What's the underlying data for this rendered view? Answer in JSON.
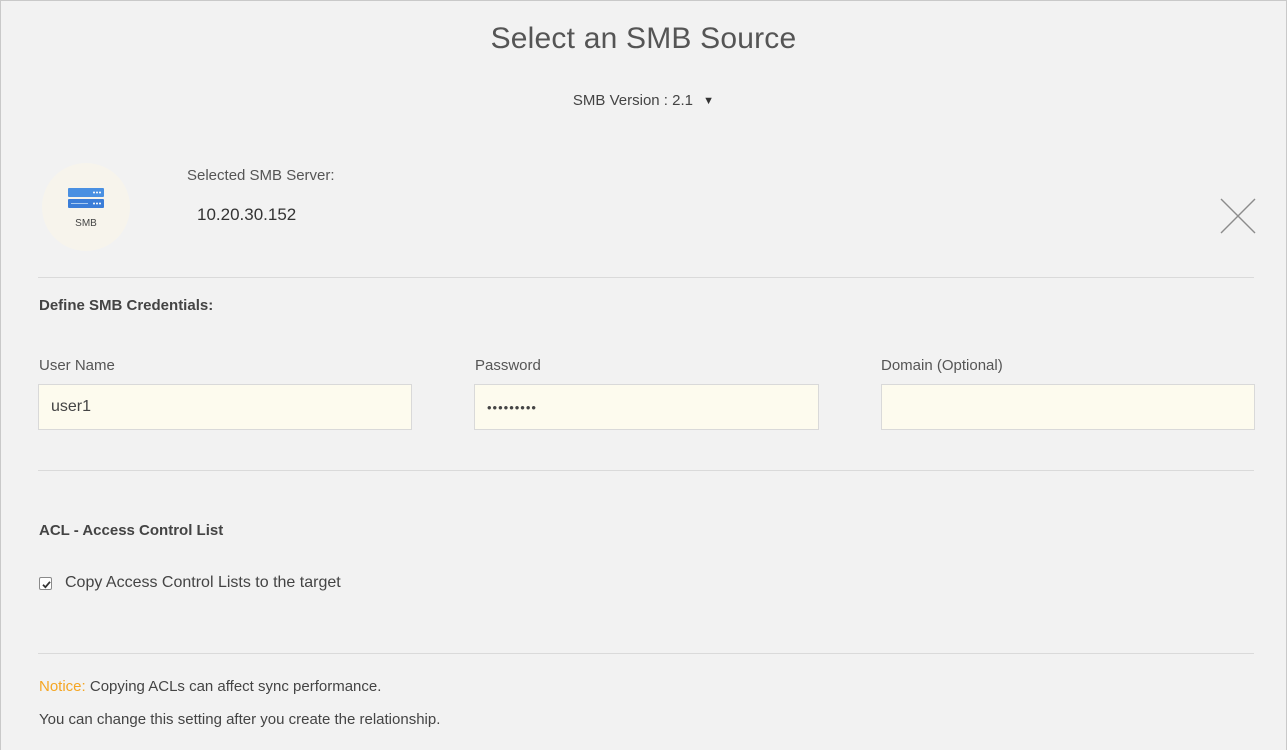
{
  "dialog": {
    "title": "Select an SMB Source",
    "version_label": "SMB Version :",
    "version_value": "2.1"
  },
  "server": {
    "icon_label": "SMB",
    "label": "Selected SMB Server:",
    "value": "10.20.30.152"
  },
  "credentials": {
    "section_title": "Define SMB Credentials:",
    "username": {
      "label": "User Name",
      "value": "user1"
    },
    "password": {
      "label": "Password",
      "value": "•••••••••"
    },
    "domain": {
      "label": "Domain (Optional)",
      "value": ""
    }
  },
  "acl": {
    "section_title": "ACL - Access Control List",
    "checkbox_label": "Copy Access Control Lists to the target",
    "checked": true
  },
  "notice": {
    "label": "Notice:",
    "text": "Copying ACLs can affect sync performance.",
    "text2": "You can change this setting after you create the relationship."
  },
  "colors": {
    "notice": "#f5a623",
    "server_icon": "#3b82d6",
    "input_bg": "#fdfbee"
  }
}
